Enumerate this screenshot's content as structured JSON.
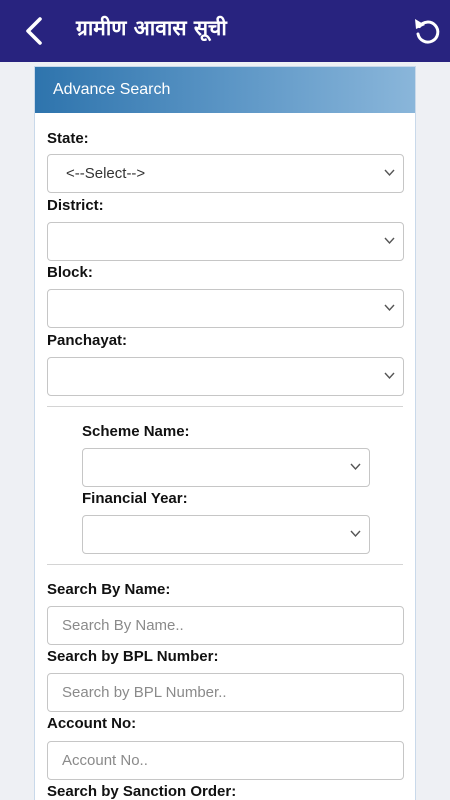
{
  "header": {
    "title": "ग्रामीण आवास सूची",
    "back_icon": "back-arrow-icon",
    "refresh_icon": "refresh-icon",
    "background_color": "#28237f"
  },
  "panel": {
    "heading": "Advance Search"
  },
  "form": {
    "state_label": "State:",
    "state_value": "<--Select-->",
    "district_label": "District:",
    "district_value": "",
    "block_label": "Block:",
    "block_value": "",
    "panchayat_label": "Panchayat:",
    "panchayat_value": "",
    "scheme_label": "Scheme Name:",
    "scheme_value": "",
    "year_label": "Financial Year:",
    "year_value": "",
    "name_label": "Search By Name:",
    "name_placeholder": "Search By Name..",
    "bpl_label": "Search by BPL Number:",
    "bpl_placeholder": "Search by BPL Number..",
    "account_label": "Account No:",
    "account_placeholder": "Account No..",
    "sanction_label": "Search by Sanction Order:"
  }
}
